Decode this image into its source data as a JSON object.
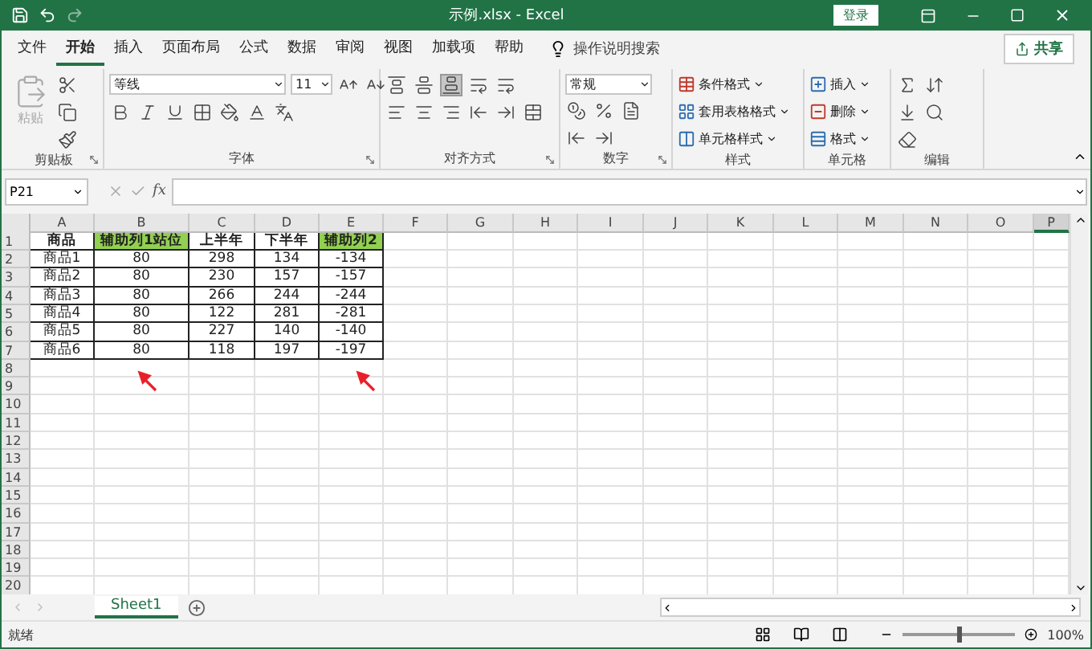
{
  "title_bar": {
    "title": "示例.xlsx  -  Excel",
    "login": "登录"
  },
  "menu_tabs": [
    {
      "label": "文件",
      "selected": false
    },
    {
      "label": "开始",
      "selected": true
    },
    {
      "label": "插入",
      "selected": false
    },
    {
      "label": "页面布局",
      "selected": false
    },
    {
      "label": "公式",
      "selected": false
    },
    {
      "label": "数据",
      "selected": false
    },
    {
      "label": "审阅",
      "selected": false
    },
    {
      "label": "视图",
      "selected": false
    },
    {
      "label": "加载项",
      "selected": false
    },
    {
      "label": "帮助",
      "selected": false
    }
  ],
  "tell_me": "操作说明搜索",
  "share": "共享",
  "ribbon": {
    "clipboard": {
      "paste": "粘贴",
      "disabled": true,
      "label": "剪贴板"
    },
    "font": {
      "name": "等线",
      "size": "11",
      "label": "字体"
    },
    "alignment": {
      "label": "对齐方式",
      "vertical": [
        {
          "selected": false
        },
        {
          "selected": false
        },
        {
          "selected": true
        }
      ]
    },
    "number": {
      "format": "常规",
      "label": "数字"
    },
    "styles": {
      "items": [
        "条件格式",
        "套用表格格式",
        "单元格样式"
      ],
      "label": "样式"
    },
    "cells": {
      "items": [
        "插入",
        "删除",
        "格式"
      ],
      "label": "单元格"
    },
    "editing": {
      "label": "编辑"
    }
  },
  "formula_bar": {
    "name_box": "P21",
    "fx": "fx"
  },
  "sheet": {
    "columns": [
      {
        "letter": "A",
        "selected": false
      },
      {
        "letter": "B",
        "selected": false
      },
      {
        "letter": "C",
        "selected": false
      },
      {
        "letter": "D",
        "selected": false
      },
      {
        "letter": "E",
        "selected": false
      },
      {
        "letter": "F",
        "selected": false
      },
      {
        "letter": "G",
        "selected": false
      },
      {
        "letter": "H",
        "selected": false
      },
      {
        "letter": "I",
        "selected": false
      },
      {
        "letter": "J",
        "selected": false
      },
      {
        "letter": "K",
        "selected": false
      },
      {
        "letter": "L",
        "selected": false
      },
      {
        "letter": "M",
        "selected": false
      },
      {
        "letter": "N",
        "selected": false
      },
      {
        "letter": "O",
        "selected": false
      },
      {
        "letter": "P",
        "selected": true
      }
    ],
    "row_numbers": [
      "1",
      "2",
      "3",
      "4",
      "5",
      "6",
      "7",
      "8",
      "9",
      "10",
      "11",
      "12",
      "13",
      "14",
      "15",
      "16",
      "17",
      "18",
      "19",
      "20"
    ],
    "header": [
      {
        "text": "商品",
        "highlight": false
      },
      {
        "text": "辅助列1站位",
        "highlight": true
      },
      {
        "text": "上半年",
        "highlight": false
      },
      {
        "text": "下半年",
        "highlight": false
      },
      {
        "text": "辅助列2",
        "highlight": true
      }
    ],
    "rows": [
      [
        "商品1",
        "80",
        "298",
        "134",
        "-134"
      ],
      [
        "商品2",
        "80",
        "230",
        "157",
        "-157"
      ],
      [
        "商品3",
        "80",
        "266",
        "244",
        "-244"
      ],
      [
        "商品4",
        "80",
        "122",
        "281",
        "-281"
      ],
      [
        "商品5",
        "80",
        "227",
        "140",
        "-140"
      ],
      [
        "商品6",
        "80",
        "118",
        "197",
        "-197"
      ]
    ]
  },
  "sheet_tabs": [
    {
      "label": "Sheet1",
      "selected": true
    }
  ],
  "status_bar": {
    "status": "就绪",
    "zoom": "100%",
    "zoom_slider": {
      "level": 0.5
    }
  }
}
